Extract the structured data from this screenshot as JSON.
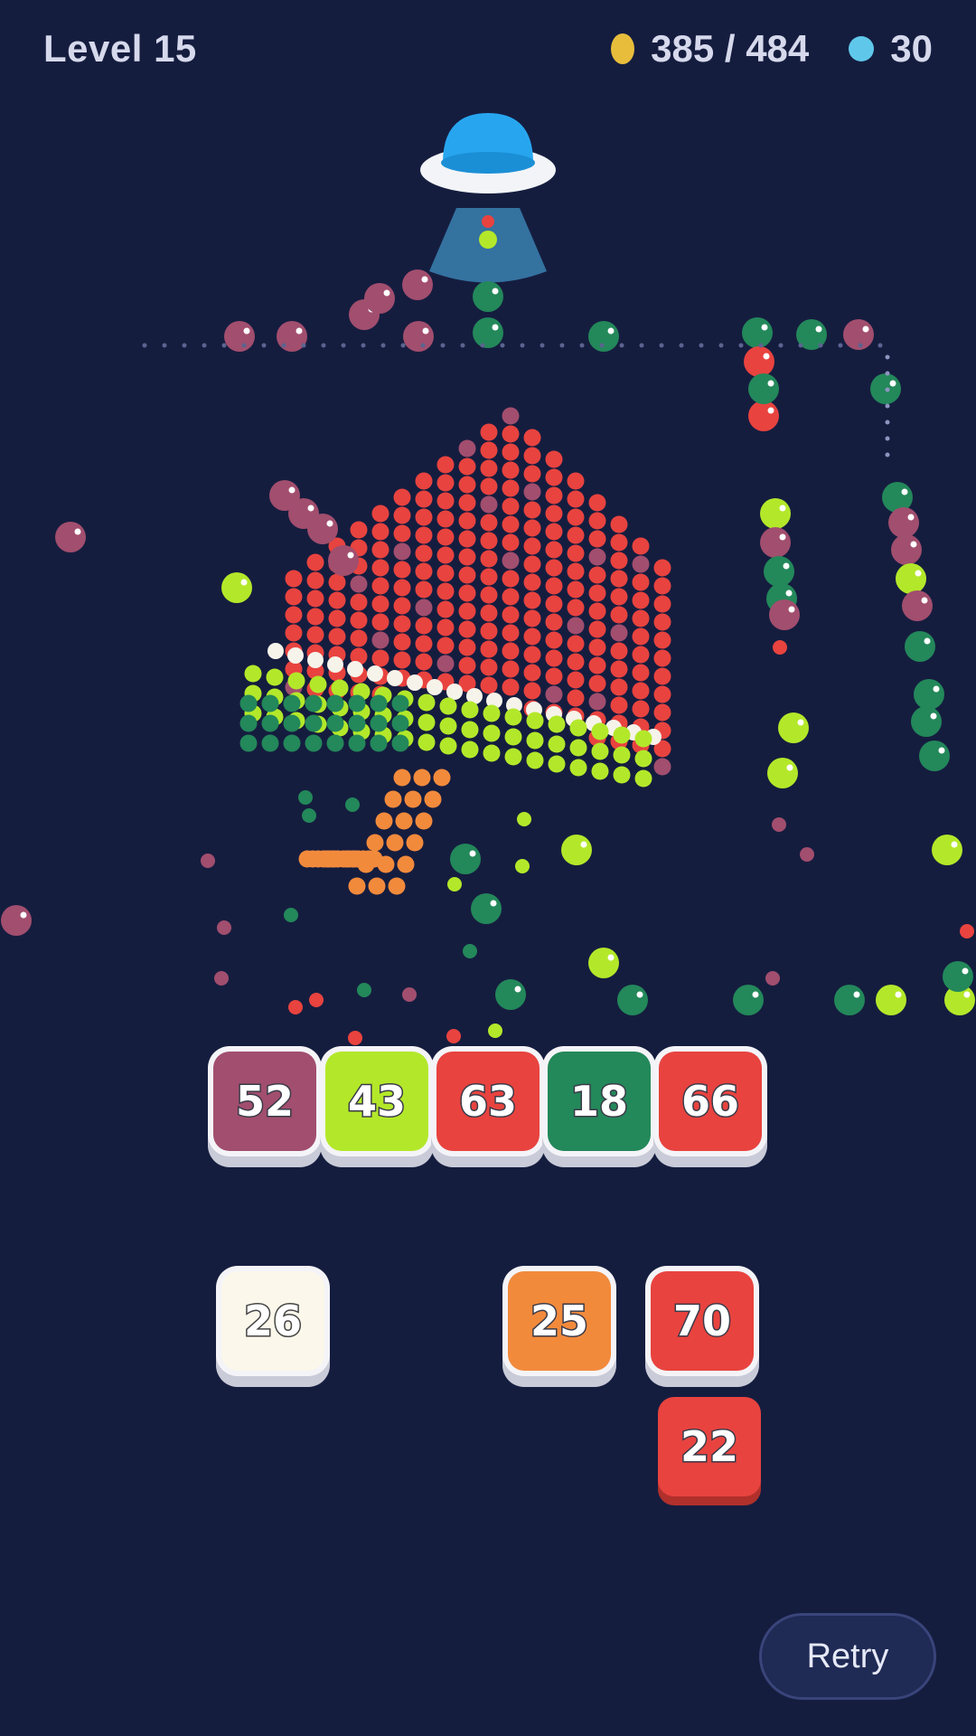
{
  "hud": {
    "level_label": "Level 15",
    "coins_text": "385 / 484",
    "gems_text": "30",
    "coin_icon": "coin-icon",
    "gem_icon": "gem-icon"
  },
  "palette": {
    "background": "#151d3f",
    "red": "#e8433f",
    "plum": "#a24e6e",
    "lime": "#b3e82a",
    "green": "#23885a",
    "orange": "#f28a3c",
    "white": "#f6f3ea"
  },
  "tray_row": [
    {
      "value": "52",
      "color": "#a24e6e"
    },
    {
      "value": "43",
      "color": "#b3e82a"
    },
    {
      "value": "63",
      "color": "#e8433f"
    },
    {
      "value": "18",
      "color": "#23885a"
    },
    {
      "value": "66",
      "color": "#e8433f"
    }
  ],
  "queue_tiles": [
    {
      "value": "26",
      "color": "#fbf7ea"
    },
    {
      "value": "25",
      "color": "#f28a3c"
    },
    {
      "value": "70",
      "color": "#e8433f"
    },
    {
      "value": "22",
      "color": "#e8433f"
    }
  ],
  "retry_label": "Retry"
}
